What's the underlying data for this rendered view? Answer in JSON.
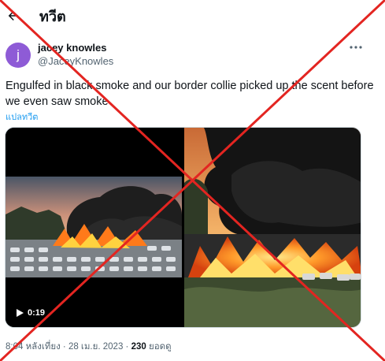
{
  "header": {
    "title": "ทวีต",
    "back_icon": "arrow-left-icon"
  },
  "author": {
    "avatar_letter": "j",
    "avatar_color": "#8e5bd6",
    "name": "jacey knowles",
    "handle": "@JaceyKnowles"
  },
  "tweet": {
    "text": "Engulfed in black smoke and our border collie picked up the scent before we even saw smoke",
    "translate_label": "แปลทวีต"
  },
  "media": {
    "video_duration": "0:19"
  },
  "meta": {
    "time": "8:04 หลังเที่ยง",
    "separator": "·",
    "date": "28 เม.ย. 2023",
    "views": "230",
    "views_label": "ยอดดู"
  },
  "colors": {
    "accent": "#1d9bf0",
    "overlay_x": "#e32521",
    "secondary_text": "#536471"
  }
}
